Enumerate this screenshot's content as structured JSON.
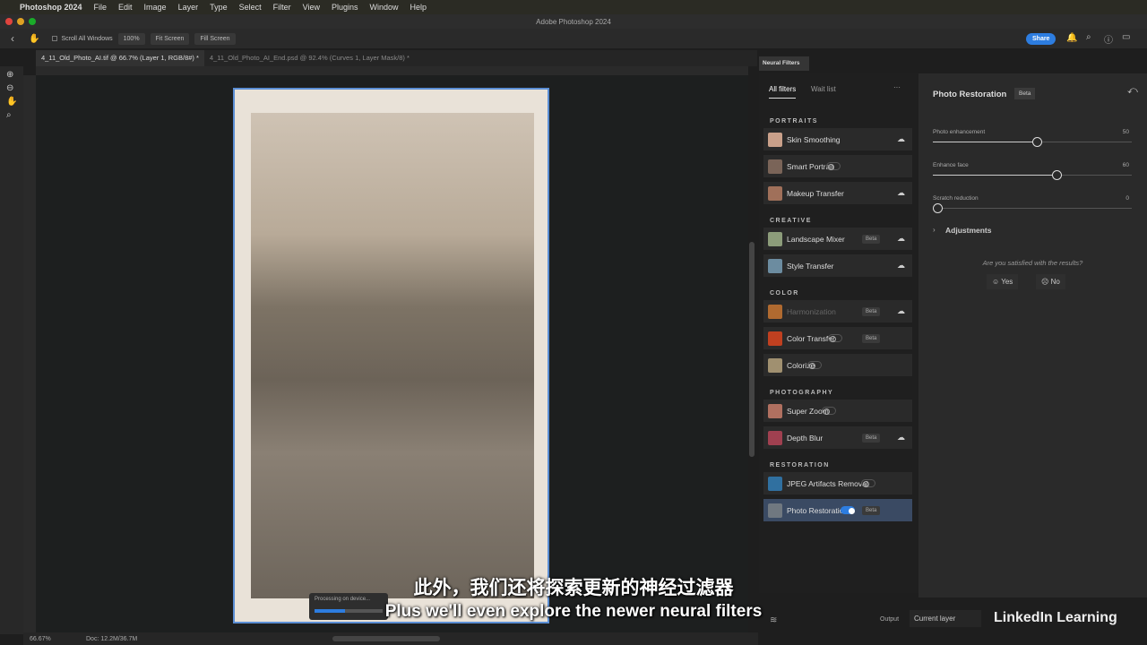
{
  "menubar": {
    "app": "Photoshop 2024",
    "items": [
      "File",
      "Edit",
      "Image",
      "Layer",
      "Type",
      "Select",
      "Filter",
      "View",
      "Plugins",
      "Window",
      "Help"
    ]
  },
  "window": {
    "title": "Adobe Photoshop 2024",
    "share": "Share"
  },
  "options": {
    "scroll_all": "Scroll All Windows",
    "zoom100": "100%",
    "fit": "Fit Screen",
    "fill": "Fill Screen"
  },
  "tabs": [
    {
      "label": "4_11_Old_Photo_AI.tif @ 66.7% (Layer 1, RGB/8#) *"
    },
    {
      "label": "4_11_Old_Photo_AI_End.psd @ 92.4% (Curves 1, Layer Mask/8) *"
    }
  ],
  "status": {
    "zoom": "66.67%",
    "doc": "Doc: 12.2M/36.7M",
    "processing": "Processing on device..."
  },
  "neural": {
    "panel_title": "Neural Filters",
    "tabs": {
      "all": "All filters",
      "wait": "Wait list",
      "more": "···"
    },
    "categories": {
      "portraits": "PORTRAITS",
      "creative": "CREATIVE",
      "color": "COLOR",
      "photography": "PHOTOGRAPHY",
      "restoration": "RESTORATION"
    },
    "items": [
      {
        "label": "Skin Smoothing",
        "control": "cloud"
      },
      {
        "label": "Smart Portrait",
        "control": "toggle-off"
      },
      {
        "label": "Makeup Transfer",
        "control": "cloud"
      },
      {
        "label": "Landscape Mixer",
        "beta": "Beta",
        "control": "cloud"
      },
      {
        "label": "Style Transfer",
        "control": "cloud"
      },
      {
        "label": "Harmonization",
        "beta": "Beta",
        "control": "cloud"
      },
      {
        "label": "Color Transfer",
        "beta": "Beta",
        "control": "toggle-off"
      },
      {
        "label": "Colorize",
        "control": "toggle-off"
      },
      {
        "label": "Super Zoom",
        "control": "toggle-off"
      },
      {
        "label": "Depth Blur",
        "beta": "Beta",
        "control": "cloud"
      },
      {
        "label": "JPEG Artifacts Removal",
        "control": "toggle-off"
      },
      {
        "label": "Photo Restoration",
        "beta": "Beta",
        "control": "toggle-on"
      }
    ],
    "detail": {
      "title": "Photo Restoration",
      "beta": "Beta",
      "sliders": [
        {
          "label": "Photo enhancement",
          "value": 50
        },
        {
          "label": "Enhance face",
          "value": 60
        },
        {
          "label": "Scratch reduction",
          "value": 0
        }
      ],
      "adjustments": "Adjustments",
      "question": "Are you satisfied with the results?",
      "yes": "Yes",
      "no": "No"
    },
    "output_label": "Output",
    "output_value": "Current layer"
  },
  "subtitles": {
    "zh": "此外，我们还将探索更新的神经过滤器",
    "en": "Plus we'll even explore the newer neural filters"
  },
  "brand": "LinkedIn Learning",
  "colors": {
    "accent": "#2d7de0",
    "selection": "#3a4a63"
  }
}
